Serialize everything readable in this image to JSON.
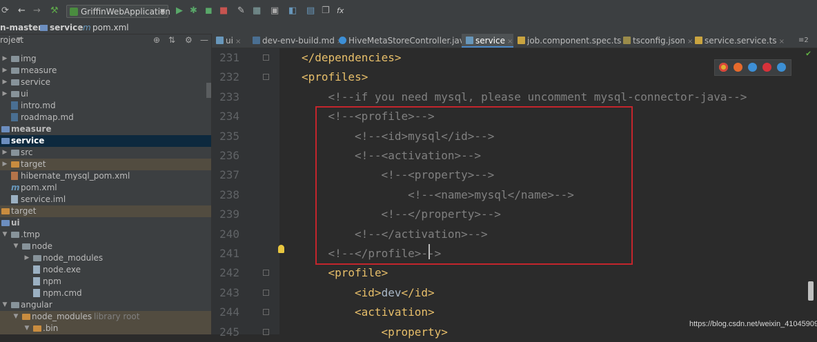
{
  "toolbar": {
    "run_config": "GriffinWebApplication",
    "fx_label": "fx"
  },
  "breadcrumb": [
    "n-master",
    "service",
    "pom.xml"
  ],
  "project": {
    "header": "roject",
    "tree": [
      {
        "label": "img",
        "kind": "folder",
        "depth": 0,
        "arrow": "▶"
      },
      {
        "label": "measure",
        "kind": "folder",
        "depth": 0,
        "arrow": "▶"
      },
      {
        "label": "service",
        "kind": "folder",
        "depth": 0,
        "arrow": "▶"
      },
      {
        "label": "ui",
        "kind": "folder",
        "depth": 0,
        "arrow": "▶"
      },
      {
        "label": "intro.md",
        "kind": "md",
        "depth": 0,
        "arrow": ""
      },
      {
        "label": "roadmap.md",
        "kind": "md",
        "depth": 0,
        "arrow": ""
      },
      {
        "label": "measure",
        "kind": "module",
        "depth": -1,
        "arrow": "",
        "bold": true
      },
      {
        "label": "service",
        "kind": "module",
        "depth": -1,
        "arrow": "",
        "bold": true,
        "selected": true
      },
      {
        "label": "src",
        "kind": "folder",
        "depth": 0,
        "arrow": "▶"
      },
      {
        "label": "target",
        "kind": "folder-orange",
        "depth": 0,
        "arrow": "▶",
        "excluded": true
      },
      {
        "label": "hibernate_mysql_pom.xml",
        "kind": "xml",
        "depth": 0,
        "arrow": ""
      },
      {
        "label": "pom.xml",
        "kind": "maven",
        "depth": 0,
        "arrow": ""
      },
      {
        "label": "service.iml",
        "kind": "file",
        "depth": 0,
        "arrow": ""
      },
      {
        "label": "target",
        "kind": "folder-orange",
        "depth": -1,
        "arrow": "",
        "excluded": true
      },
      {
        "label": "ui",
        "kind": "module",
        "depth": -1,
        "arrow": "",
        "bold": true
      },
      {
        "label": ".tmp",
        "kind": "folder",
        "depth": 0,
        "arrow": "▼"
      },
      {
        "label": "node",
        "kind": "folder",
        "depth": 1,
        "arrow": "▼"
      },
      {
        "label": "node_modules",
        "kind": "folder",
        "depth": 2,
        "arrow": "▶"
      },
      {
        "label": "node.exe",
        "kind": "file",
        "depth": 2,
        "arrow": ""
      },
      {
        "label": "npm",
        "kind": "file",
        "depth": 2,
        "arrow": ""
      },
      {
        "label": "npm.cmd",
        "kind": "file",
        "depth": 2,
        "arrow": ""
      },
      {
        "label": "angular",
        "kind": "folder",
        "depth": 0,
        "arrow": "▼"
      },
      {
        "label": "node_modules",
        "kind": "folder-orange",
        "depth": 1,
        "arrow": "▼",
        "excluded": true,
        "suffix": "library root"
      },
      {
        "label": ".bin",
        "kind": "folder-orange",
        "depth": 2,
        "arrow": "▼",
        "excluded": true
      }
    ]
  },
  "tabs": [
    {
      "label": "ui",
      "kind": "maven"
    },
    {
      "label": "dev-env-build.md",
      "kind": "md"
    },
    {
      "label": "HiveMetaStoreController.java",
      "kind": "java"
    },
    {
      "label": "service",
      "kind": "maven",
      "active": true
    },
    {
      "label": "job.component.spec.ts",
      "kind": "ts"
    },
    {
      "label": "tsconfig.json",
      "kind": "json"
    },
    {
      "label": "service.service.ts",
      "kind": "ts"
    }
  ],
  "tabs_overflow": "≡2",
  "editor": {
    "lines": [
      {
        "num": "231",
        "indent": 2,
        "parts": [
          {
            "c": "tag",
            "t": "</dependencies>"
          }
        ]
      },
      {
        "num": "232",
        "indent": 2,
        "parts": [
          {
            "c": "tag",
            "t": "<profiles>"
          }
        ]
      },
      {
        "num": "233",
        "indent": 4,
        "parts": [
          {
            "c": "cmt",
            "t": "<!--if you need mysql, please uncomment mysql-connector-java-->"
          }
        ]
      },
      {
        "num": "234",
        "indent": 4,
        "parts": [
          {
            "c": "cmt",
            "t": "<!--<profile>-->"
          }
        ]
      },
      {
        "num": "235",
        "indent": 6,
        "parts": [
          {
            "c": "cmt",
            "t": "<!--<id>mysql</id>-->"
          }
        ]
      },
      {
        "num": "236",
        "indent": 6,
        "parts": [
          {
            "c": "cmt",
            "t": "<!--<activation>-->"
          }
        ]
      },
      {
        "num": "237",
        "indent": 8,
        "parts": [
          {
            "c": "cmt",
            "t": "<!--<property>-->"
          }
        ]
      },
      {
        "num": "238",
        "indent": 10,
        "parts": [
          {
            "c": "cmt",
            "t": "<!--<name>mysql</name>-->"
          }
        ]
      },
      {
        "num": "239",
        "indent": 8,
        "parts": [
          {
            "c": "cmt",
            "t": "<!--</property>-->"
          }
        ]
      },
      {
        "num": "240",
        "indent": 6,
        "parts": [
          {
            "c": "cmt",
            "t": "<!--</activation>-->"
          }
        ]
      },
      {
        "num": "241",
        "indent": 4,
        "parts": [
          {
            "c": "cmt",
            "t": "<!--</profile>-->"
          }
        ]
      },
      {
        "num": "242",
        "indent": 4,
        "parts": [
          {
            "c": "tag",
            "t": "<profile>"
          }
        ]
      },
      {
        "num": "243",
        "indent": 6,
        "parts": [
          {
            "c": "tag",
            "t": "<id>"
          },
          {
            "c": "txt",
            "t": "dev"
          },
          {
            "c": "tag",
            "t": "</id>"
          }
        ]
      },
      {
        "num": "244",
        "indent": 6,
        "parts": [
          {
            "c": "tag",
            "t": "<activation>"
          }
        ]
      },
      {
        "num": "245",
        "indent": 8,
        "parts": [
          {
            "c": "tag",
            "t": "<property>"
          }
        ]
      }
    ]
  },
  "watermark": "https://blog.csdn.net/weixin_41045909",
  "colors": {
    "tag": "#e8bf6a",
    "comment": "#808080",
    "highlight_box": "#c4252c",
    "selection": "#0d293e"
  }
}
